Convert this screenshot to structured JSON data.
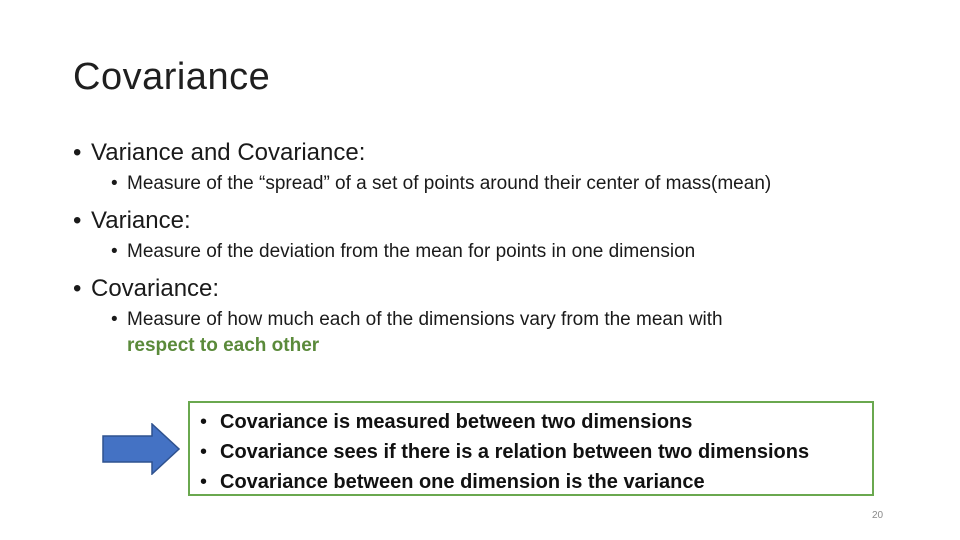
{
  "slide": {
    "title": "Covariance",
    "bullets": [
      {
        "text": "Variance and Covariance:",
        "subbullets": [
          {
            "text": "Measure of the “spread” of a set of points around their center of mass(mean)",
            "highlight": ""
          }
        ]
      },
      {
        "text": "Variance:",
        "subbullets": [
          {
            "text": "Measure of the deviation from the mean for points in one dimension",
            "highlight": ""
          }
        ]
      },
      {
        "text": "Covariance:",
        "subbullets": [
          {
            "text": "Measure of how much each of the dimensions vary from the mean with",
            "highlight": "respect to each other"
          }
        ]
      }
    ],
    "callout": {
      "items": [
        "Covariance is measured between two dimensions",
        "Covariance sees if there is a relation between two dimensions",
        "Covariance between one dimension is the variance"
      ]
    },
    "arrow_icon": "right-arrow-icon",
    "page_number": "20",
    "colors": {
      "accent_green": "#5a8a3a",
      "callout_border": "#6aa84f",
      "arrow_fill": "#4472c4",
      "arrow_stroke": "#2f528f"
    }
  }
}
